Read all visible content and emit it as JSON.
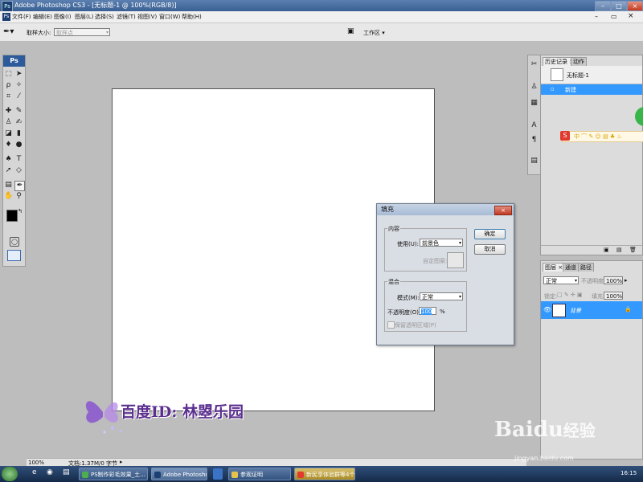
{
  "window": {
    "title": "Adobe Photoshop CS3 - [无标题-1 @ 100%(RGB/8)]",
    "app_icon": "Ps"
  },
  "menu": [
    "文件(F)",
    "编辑(E)",
    "图像(I)",
    "图层(L)",
    "选择(S)",
    "滤镜(T)",
    "视图(V)",
    "窗口(W)",
    "帮助(H)"
  ],
  "options_bar": {
    "sample_size_label": "取样大小:",
    "sample_size_value": "取样点",
    "workspace_label": "工作区"
  },
  "toolbox": {
    "header": "Ps"
  },
  "history_panel": {
    "tabs": [
      "历史记录",
      "动作"
    ],
    "snapshot": "无标题-1",
    "items": [
      "新建"
    ]
  },
  "layers_panel": {
    "tabs": [
      "图层",
      "通道",
      "路径"
    ],
    "blend_mode": "正常",
    "opacity_label": "不透明度:",
    "opacity_value": "100%",
    "lock_label": "锁定:",
    "fill_label": "填充:",
    "fill_value": "100%",
    "layer_name": "背景"
  },
  "fill_dialog": {
    "title": "填充",
    "contents_group": "内容",
    "use_label": "使用(U):",
    "use_value": "前景色",
    "custom_pattern_label": "自定图案:",
    "blending_group": "混合",
    "mode_label": "模式(M):",
    "mode_value": "正常",
    "opacity_label": "不透明度(O):",
    "opacity_value": "100",
    "opacity_unit": "%",
    "preserve_transparency": "保留透明区域(P)",
    "ok": "确定",
    "cancel": "取消"
  },
  "status": {
    "zoom": "100%",
    "doc_info": "文档:1.37M/0 字节"
  },
  "taskbar": {
    "items": [
      "PS制作彩毛效果_土...",
      "Adobe Photoshop ...",
      "参观证明",
      "新民享体验群等4个..."
    ],
    "clock": "16:15"
  },
  "watermark": {
    "text": "百度ID: 林曌乐园",
    "brand": "Baidu",
    "brand_cn": "经验",
    "site": "jingyan.baidu.com"
  },
  "colors": {
    "accent": "#3399ff",
    "title_bar": "#3a5f92",
    "taskbar": "#1c3557"
  }
}
